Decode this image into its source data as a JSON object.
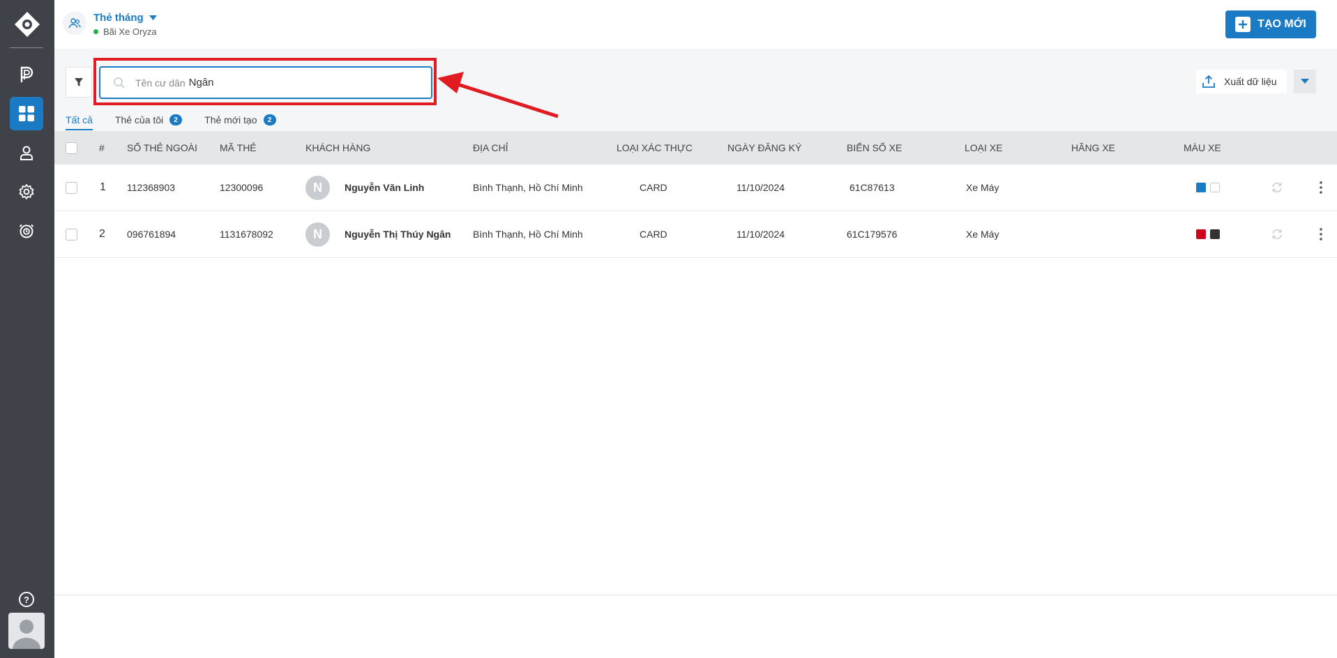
{
  "header": {
    "title": "Thẻ tháng",
    "subtitle": "Bãi Xe Oryza",
    "create_label": "TẠO MỚI"
  },
  "search": {
    "placeholder": "Tên cư dân",
    "value": "Ngân"
  },
  "export": {
    "label": "Xuất dữ liệu"
  },
  "tabs": [
    {
      "label": "Tất cả",
      "badge": null,
      "active": true
    },
    {
      "label": "Thẻ của tôi",
      "badge": "2",
      "active": false
    },
    {
      "label": "Thẻ mới tạo",
      "badge": "2",
      "active": false
    }
  ],
  "table": {
    "columns": [
      "#",
      "SỐ THẺ NGOÀI",
      "MÃ THẺ",
      "KHÁCH HÀNG",
      "ĐỊA CHỈ",
      "LOẠI XÁC THỰC",
      "NGÀY ĐĂNG KÝ",
      "BIỂN SỐ XE",
      "LOẠI XE",
      "HÃNG XE",
      "MÀU XE"
    ],
    "rows": [
      {
        "index": "1",
        "outer_card": "112368903",
        "card_code": "12300096",
        "avatar_initial": "N",
        "customer": "Nguyễn Văn Linh",
        "address": "Bình Thạnh, Hồ Chí Minh",
        "auth_type": "CARD",
        "reg_date": "11/10/2024",
        "plate": "61C87613",
        "vehicle_type": "Xe Máy",
        "brand": "",
        "colors": [
          "#1a7ac4",
          "#ffffff"
        ]
      },
      {
        "index": "2",
        "outer_card": "096761894",
        "card_code": "1131678092",
        "avatar_initial": "N",
        "customer": "Nguyễn Thị Thúy Ngân",
        "address": "Bình Thạnh, Hồ Chí Minh",
        "auth_type": "CARD",
        "reg_date": "11/10/2024",
        "plate": "61C179576",
        "vehicle_type": "Xe Máy",
        "brand": "",
        "colors": [
          "#d0021b",
          "#333333"
        ]
      }
    ]
  },
  "colors": {
    "accent": "#1a7ac4",
    "sidebar": "#3f4349",
    "highlight": "#e01b22",
    "status_online": "#22b04b"
  }
}
